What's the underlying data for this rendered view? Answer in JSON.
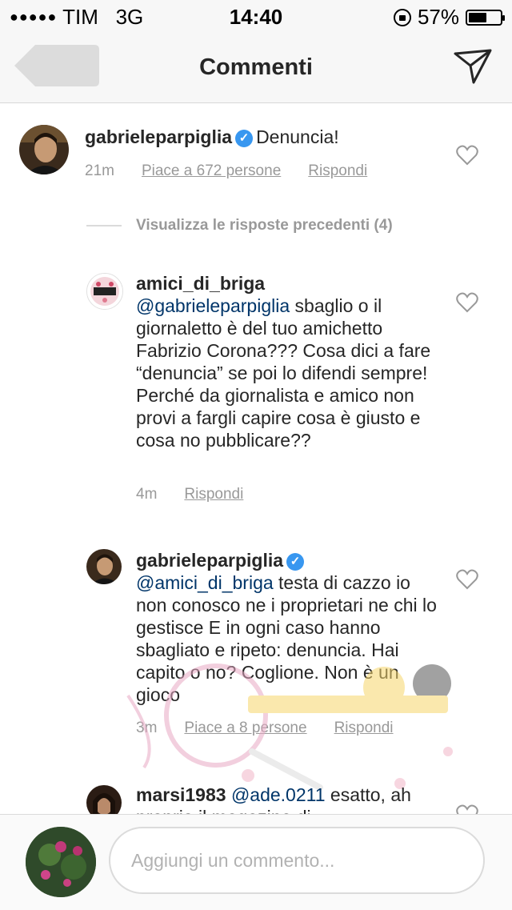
{
  "status": {
    "signal": "●●●●●",
    "carrier": "TIM",
    "network": "3G",
    "time": "14:40",
    "battery_text": "57%",
    "battery_level": 0.57
  },
  "nav": {
    "title": "Commenti",
    "back_icon": "back-arrow-icon",
    "send_icon": "paper-plane-icon"
  },
  "caption": {
    "username": "gabrieleparpiglia",
    "verified": true,
    "text": "Denuncia!",
    "time": "21m",
    "likes": "Piace a 672 persone",
    "reply": "Rispondi"
  },
  "previous_replies": "Visualizza le risposte precedenti (4)",
  "replies": [
    {
      "username": "amici_di_briga",
      "verified": false,
      "mention": "@gabrieleparpiglia",
      "text": " sbaglio o il giornaletto è del tuo amichetto Fabrizio Corona??? Cosa dici a fare “denuncia” se poi lo difendi sempre! Perché da giornalista e amico non provi a fargli capire cosa è giusto e cosa no pubblicare??",
      "time": "4m",
      "reply": "Rispondi"
    },
    {
      "username": "gabrieleparpiglia",
      "verified": true,
      "mention": "@amici_di_briga",
      "text": " testa di cazzo io non conosco ne i proprietari ne chi lo gestisce E in ogni caso hanno sbagliato e ripeto: denuncia. Hai capito o no? Coglione. Non è un gioco",
      "time": "3m",
      "likes": "Piace a 8 persone",
      "reply": "Rispondi"
    },
    {
      "username": "marsi1983",
      "verified": false,
      "mention": "@ade.0211",
      "text": " esatto, ah proprio il magazine di"
    }
  ],
  "composer": {
    "placeholder": "Aggiungi un commento..."
  },
  "colors": {
    "accent": "#3897f0",
    "mention": "#003569",
    "secondary": "#999999"
  }
}
